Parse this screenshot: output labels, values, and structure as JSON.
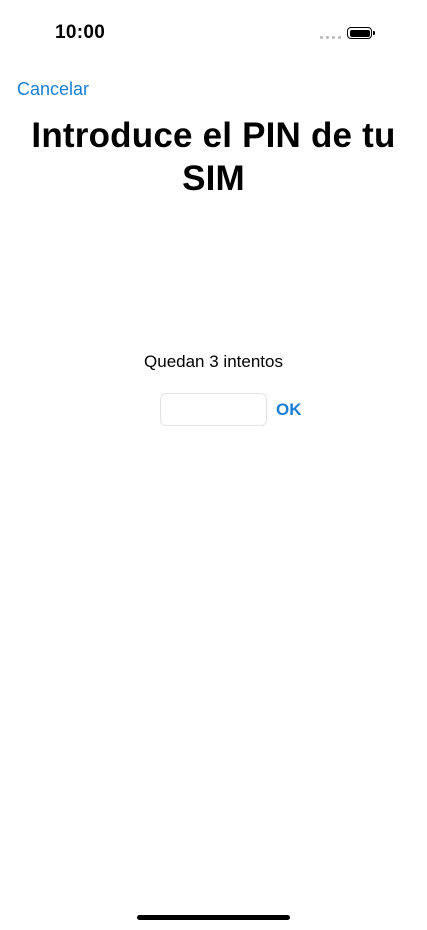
{
  "status_bar": {
    "time": "10:00"
  },
  "nav": {
    "cancel_label": "Cancelar"
  },
  "title": "Introduce el PIN de tu SIM",
  "attempts_text": "Quedan 3 intentos",
  "pin_field": {
    "value": "",
    "placeholder": ""
  },
  "ok_label": "OK",
  "icons": {
    "signal": "signal-dots-icon",
    "battery": "battery-icon"
  },
  "colors": {
    "accent": "#1a7fd4",
    "text": "#000000",
    "background": "#ffffff"
  }
}
